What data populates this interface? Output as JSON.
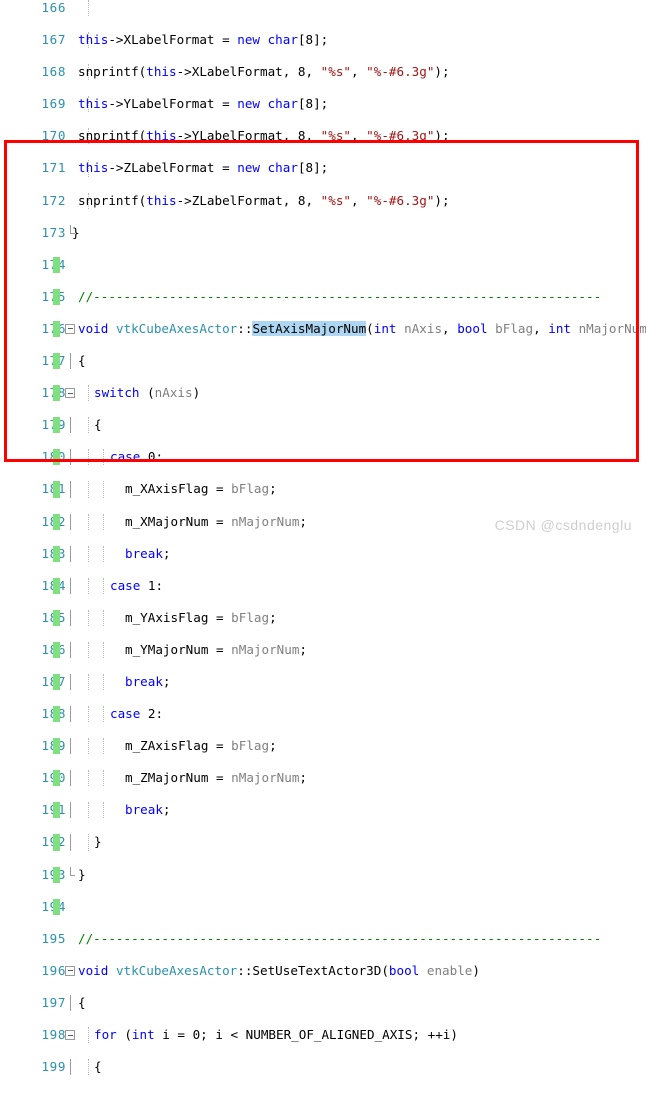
{
  "editor": {
    "first_line": 166,
    "last_line": 199,
    "watermark": "CSDN @csdndenglu",
    "colors": {
      "keyword": "#0000ff",
      "type": "#2b91af",
      "string": "#a31515",
      "comment": "#008000",
      "variable": "#808080",
      "line_number": "#2b91af",
      "change_bar": "#7fe07f",
      "selection": "#add6f2",
      "annotation": "#ff0000",
      "background": "#ffffff"
    },
    "annotation": {
      "shape": "rectangle",
      "color": "#ff0000",
      "covers_lines": "175-194"
    }
  },
  "lines": [
    {
      "n": 166,
      "text": ""
    },
    {
      "n": 167,
      "text": "    this->XLabelFormat = new char[8];"
    },
    {
      "n": 168,
      "text": "    snprintf(this->XLabelFormat, 8, \"%s\", \"%-#6.3g\");"
    },
    {
      "n": 169,
      "text": "    this->YLabelFormat = new char[8];"
    },
    {
      "n": 170,
      "text": "    snprintf(this->YLabelFormat, 8, \"%s\", \"%-#6.3g\");"
    },
    {
      "n": 171,
      "text": "    this->ZLabelFormat = new char[8];"
    },
    {
      "n": 172,
      "text": "    snprintf(this->ZLabelFormat, 8, \"%s\", \"%-#6.3g\");"
    },
    {
      "n": 173,
      "text": "  }"
    },
    {
      "n": 174,
      "text": ""
    },
    {
      "n": 175,
      "text": "  //-------------------------------------------------------------------"
    },
    {
      "n": 176,
      "text": "void vtkCubeAxesActor::SetAxisMajorNum(int nAxis, bool bFlag, int nMajorNum)"
    },
    {
      "n": 177,
      "text": "  {"
    },
    {
      "n": 178,
      "text": "   switch (nAxis)"
    },
    {
      "n": 179,
      "text": "    {"
    },
    {
      "n": 180,
      "text": "     case 0:"
    },
    {
      "n": 181,
      "text": "       m_XAxisFlag = bFlag;"
    },
    {
      "n": 182,
      "text": "       m_XMajorNum = nMajorNum;"
    },
    {
      "n": 183,
      "text": "       break;"
    },
    {
      "n": 184,
      "text": "     case 1:"
    },
    {
      "n": 185,
      "text": "       m_YAxisFlag = bFlag;"
    },
    {
      "n": 186,
      "text": "       m_YMajorNum = nMajorNum;"
    },
    {
      "n": 187,
      "text": "       break;"
    },
    {
      "n": 188,
      "text": "     case 2:"
    },
    {
      "n": 189,
      "text": "       m_ZAxisFlag = bFlag;"
    },
    {
      "n": 190,
      "text": "       m_ZMajorNum = nMajorNum;"
    },
    {
      "n": 191,
      "text": "       break;"
    },
    {
      "n": 192,
      "text": "    }"
    },
    {
      "n": 193,
      "text": "  }"
    },
    {
      "n": 194,
      "text": ""
    },
    {
      "n": 195,
      "text": "  //-------------------------------------------------------------------"
    },
    {
      "n": 196,
      "text": "void vtkCubeAxesActor::SetUseTextActor3D(bool enable)"
    },
    {
      "n": 197,
      "text": "  {"
    },
    {
      "n": 198,
      "text": "   for (int i = 0; i < NUMBER_OF_ALIGNED_AXIS; ++i)"
    },
    {
      "n": 199,
      "text": "    {"
    }
  ],
  "selection": {
    "token": "SetAxisMajorNum",
    "line": 176
  }
}
